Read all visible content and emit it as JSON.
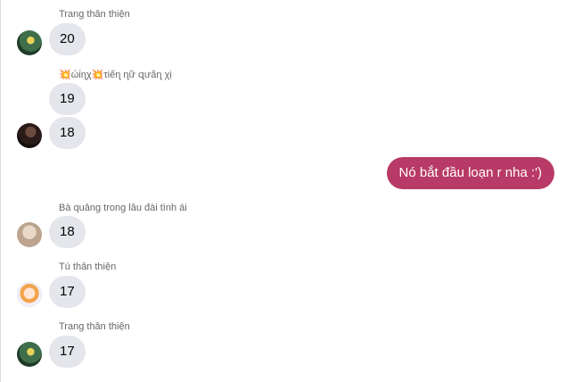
{
  "messages": [
    {
      "sender": "Trang thân thiện",
      "avatar_icon": "avatar-green-photo",
      "bubbles": [
        "20"
      ]
    },
    {
      "sender": "💥ώίɳχ💥τiếɳ ɳữ զưãɳ χị",
      "avatar_icon": "avatar-dark-photo",
      "bubbles": [
        "19",
        "18"
      ]
    },
    {
      "sender": "",
      "mine": true,
      "bubbles": [
        "Nó bắt đầu loạn r nha :')"
      ]
    },
    {
      "sender": "Bà quảng trong lâu đài tình ái",
      "avatar_icon": "avatar-beige-photo",
      "bubbles": [
        "18"
      ]
    },
    {
      "sender": "Tú thân thiện",
      "avatar_icon": "avatar-anime-photo",
      "bubbles": [
        "17"
      ]
    },
    {
      "sender": "Trang thân thiện",
      "avatar_icon": "avatar-green-photo",
      "bubbles": [
        "17"
      ]
    }
  ],
  "colors": {
    "own_bubble": "#b83a66",
    "other_bubble": "#e4e6eb",
    "sender_text": "#65676b"
  }
}
